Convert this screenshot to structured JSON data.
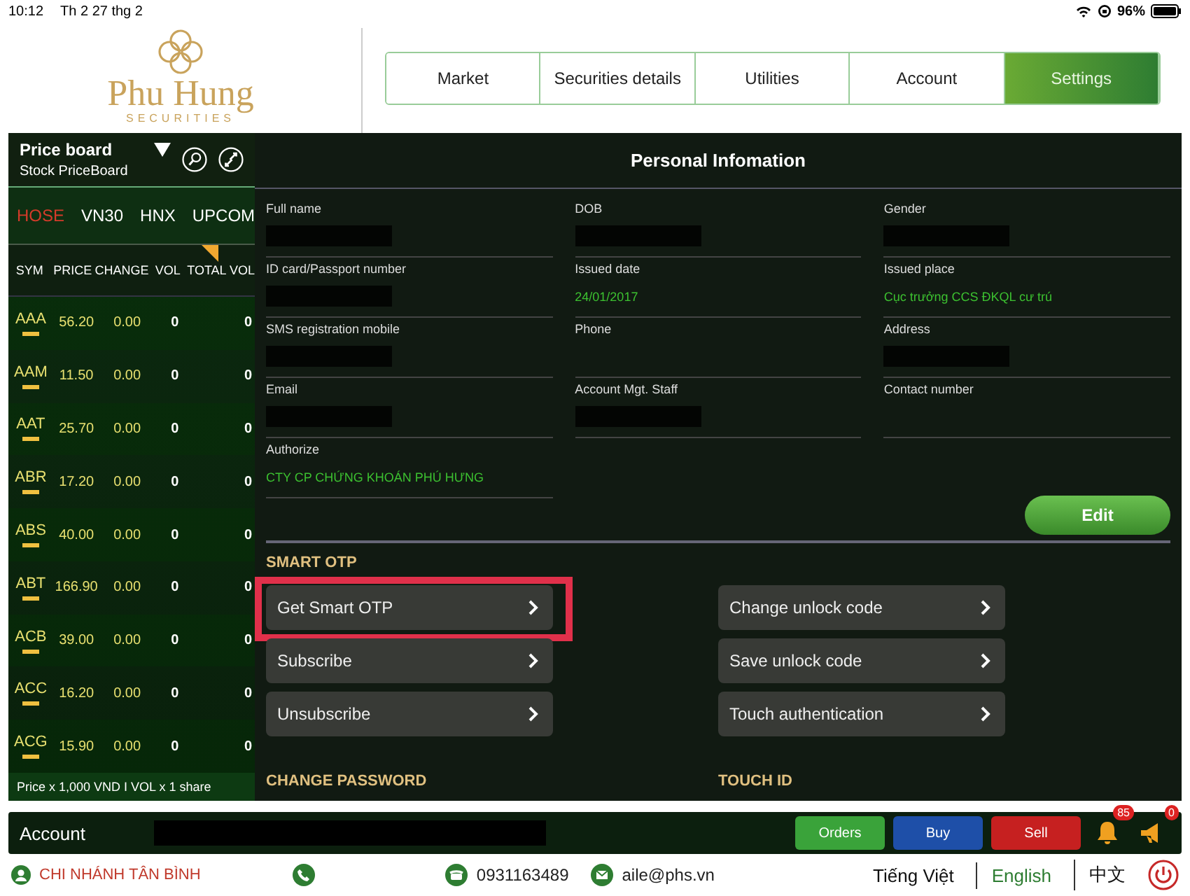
{
  "status_bar": {
    "time": "10:12",
    "date": "Th 2 27 thg 2",
    "battery": "96%"
  },
  "logo": {
    "name": "Phu Hung",
    "tagline": "SECURITIES"
  },
  "main_tabs": [
    {
      "label": "Market",
      "selected": false
    },
    {
      "label": "Securities details",
      "selected": false
    },
    {
      "label": "Utilities",
      "selected": false
    },
    {
      "label": "Account",
      "selected": false
    },
    {
      "label": "Settings",
      "selected": true
    }
  ],
  "price_board": {
    "title": "Price board",
    "subtitle": "Stock PriceBoard",
    "exchanges": [
      {
        "label": "HOSE",
        "selected": true
      },
      {
        "label": "VN30",
        "selected": false
      },
      {
        "label": "HNX",
        "selected": false
      },
      {
        "label": "UPCOM",
        "selected": false
      }
    ],
    "columns": [
      "SYM",
      "PRICE",
      "CHANGE",
      "VOL",
      "TOTAL VOL"
    ],
    "rows": [
      [
        "AAA",
        "56.20",
        "0.00",
        "0",
        "0"
      ],
      [
        "AAM",
        "11.50",
        "0.00",
        "0",
        "0"
      ],
      [
        "AAT",
        "25.70",
        "0.00",
        "0",
        "0"
      ],
      [
        "ABR",
        "17.20",
        "0.00",
        "0",
        "0"
      ],
      [
        "ABS",
        "40.00",
        "0.00",
        "0",
        "0"
      ],
      [
        "ABT",
        "166.90",
        "0.00",
        "0",
        "0"
      ],
      [
        "ACB",
        "39.00",
        "0.00",
        "0",
        "0"
      ],
      [
        "ACC",
        "16.20",
        "0.00",
        "0",
        "0"
      ],
      [
        "ACG",
        "15.90",
        "0.00",
        "0",
        "0"
      ]
    ],
    "footnote": "Price x 1,000 VND I VOL x 1 share"
  },
  "personal": {
    "title": "Personal Infomation",
    "fields": [
      {
        "label": "Full name",
        "redacted": true
      },
      {
        "label": "DOB",
        "redacted": true
      },
      {
        "label": "Gender",
        "redacted": true
      },
      {
        "label": "ID card/Passport number",
        "redacted": true
      },
      {
        "label": "Issued date",
        "value": "24/01/2017",
        "redacted": false
      },
      {
        "label": "Issued place",
        "value": "Cục trưởng CCS ĐKQL cư trú",
        "redacted": false
      },
      {
        "label": "SMS registration mobile",
        "redacted": true
      },
      {
        "label": "Phone",
        "redacted": false
      },
      {
        "label": "Address",
        "redacted": true
      },
      {
        "label": "Email",
        "redacted": true
      },
      {
        "label": "Account Mgt. Staff",
        "redacted": true
      },
      {
        "label": "Contact number",
        "redacted": false
      },
      {
        "label": "Authorize",
        "value": "CTY CP CHỨNG KHOÁN PHÚ HƯNG",
        "redacted": false
      }
    ],
    "edit_button": "Edit"
  },
  "smart_otp": {
    "title": "SMART OTP",
    "left": [
      {
        "label": "Get Smart OTP",
        "highlighted": true
      },
      {
        "label": "Subscribe",
        "highlighted": false
      },
      {
        "label": "Unsubscribe",
        "highlighted": false
      }
    ],
    "right": [
      {
        "label": "Change unlock code",
        "highlighted": false
      },
      {
        "label": "Save unlock code",
        "highlighted": false
      },
      {
        "label": "Touch authentication",
        "highlighted": false
      }
    ]
  },
  "sections": [
    "CHANGE PASSWORD",
    "TOUCH ID"
  ],
  "account_bar": {
    "label": "Account",
    "buttons": [
      {
        "label": "Orders",
        "kind": "orders"
      },
      {
        "label": "Buy",
        "kind": "buy"
      },
      {
        "label": "Sell",
        "kind": "sell"
      }
    ],
    "notifications": "85",
    "announcements": "0"
  },
  "footer": {
    "branch": "CHI NHÁNH TÂN BÌNH",
    "phone": "0931163489",
    "email": "aile@phs.vn",
    "languages": [
      {
        "label": "Tiếng Việt",
        "selected": false
      },
      {
        "label": "English",
        "selected": true
      },
      {
        "label": "中文",
        "selected": false
      }
    ]
  }
}
